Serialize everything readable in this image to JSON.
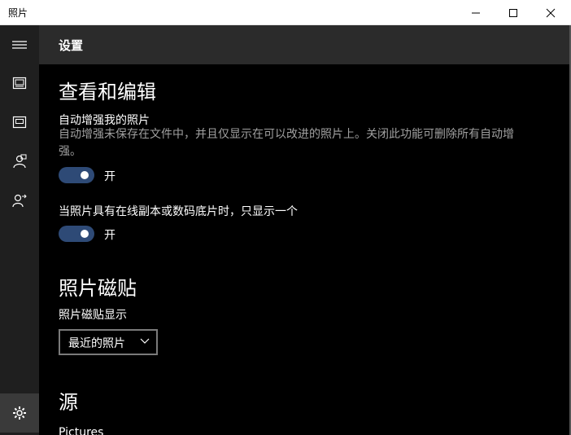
{
  "window": {
    "title": "照片",
    "controls": {
      "minimize": "minimize",
      "maximize": "maximize",
      "close": "close"
    }
  },
  "nav": {
    "items": [
      {
        "icon": "hamburger-menu-icon"
      },
      {
        "icon": "collection-icon"
      },
      {
        "icon": "album-icon"
      },
      {
        "icon": "people-icon"
      },
      {
        "icon": "share-icon"
      }
    ],
    "settings_icon": "gear-icon"
  },
  "header": {
    "title": "设置"
  },
  "sections": {
    "view_edit": {
      "title": "查看和编辑",
      "auto_enhance": {
        "label": "自动增强我的照片",
        "description": "自动增强未保存在文件中，并且仅显示在可以改进的照片上。关闭此功能可删除所有自动增强。",
        "state": "开"
      },
      "linked_duplicates": {
        "label": "当照片具有在线副本或数码底片时，只显示一个",
        "state": "开"
      }
    },
    "tile": {
      "title": "照片磁贴",
      "label": "照片磁贴显示",
      "dropdown_value": "最近的照片"
    },
    "sources": {
      "title": "源",
      "first_item": "Pictures"
    }
  },
  "colors": {
    "toggle_on": "#2e4a76",
    "nav_bg": "#1f1f1f",
    "header_bg": "#2b2b2b",
    "content_bg": "#000000",
    "desc_text": "#a0a0a0"
  }
}
